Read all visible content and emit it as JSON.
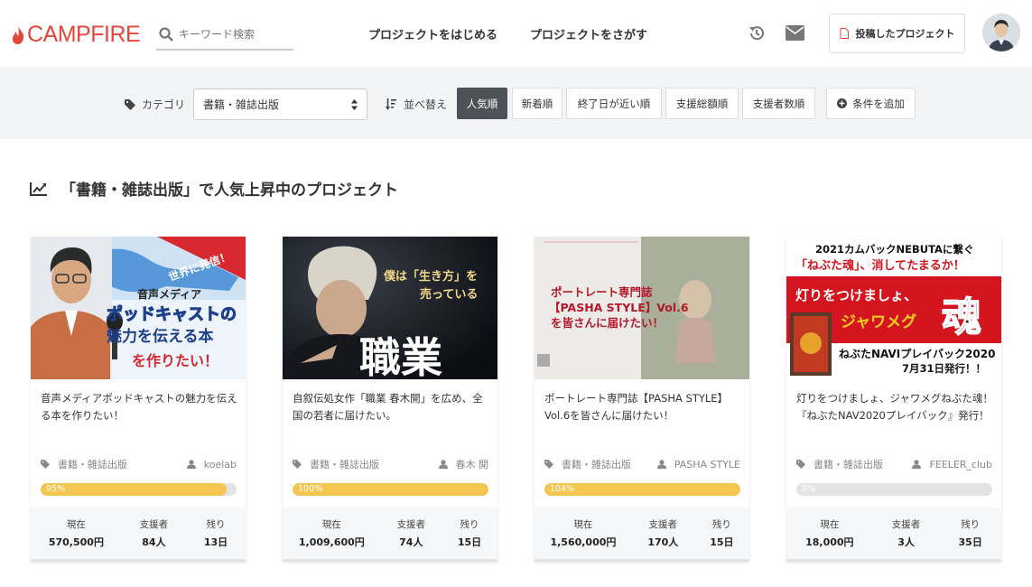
{
  "header": {
    "logo": "CAMPFIRE",
    "search_placeholder": "キーワード検索",
    "nav": [
      "プロジェクトをはじめる",
      "プロジェクトをさがす"
    ],
    "posted_projects": "投稿したプロジェクト"
  },
  "filters": {
    "category_label": "カテゴリ",
    "category_value": "書籍・雑誌出版",
    "sort_label": "並べ替え",
    "sort_options": [
      "人気順",
      "新着順",
      "終了日が近い順",
      "支援総額順",
      "支援者数順"
    ],
    "active_sort": "人気順",
    "add_condition": "条件を追加"
  },
  "section_title": "「書籍・雑誌出版」で人気上昇中のプロジェクト",
  "stat_labels": {
    "current": "現在",
    "backers": "支援者",
    "remaining": "残り"
  },
  "cards": [
    {
      "title": "音声メディアポッドキャストの魅力を伝える本を作りたい！",
      "category": "書籍・雑誌出版",
      "owner": "koelab",
      "progress_label": "95%",
      "progress_value": 0.95,
      "current": "570,500円",
      "backers": "84人",
      "remaining": "13日",
      "image_texts": [
        "世界に発信！",
        "音声メディア",
        "ポッドキャストの",
        "魅力を伝える本",
        "を作りたい！"
      ]
    },
    {
      "title": "自叙伝処女作「職業 春木開」を広め、全国の若者に届けたい。",
      "category": "書籍・雑誌出版",
      "owner": "春木 開",
      "progress_label": "100%",
      "progress_value": 1.0,
      "current": "1,009,600円",
      "backers": "74人",
      "remaining": "15日",
      "image_texts": [
        "僕は「生き方」を",
        "売っている",
        "職業"
      ]
    },
    {
      "title": "ポートレート専門誌【PASHA STYLE】Vol.6を皆さんに届けたい！",
      "category": "書籍・雑誌出版",
      "owner": "PASHA STYLE",
      "progress_label": "104%",
      "progress_value": 1.0,
      "current": "1,560,000円",
      "backers": "170人",
      "remaining": "15日",
      "image_texts": [
        "ポートレート専門誌",
        "【PASHA STYLE】Vol.6",
        "を皆さんに届けたい！"
      ]
    },
    {
      "title": "灯りをつけましょ、ジャワメグねぶた魂！『ねぶたNAV2020プレイバック』発行！",
      "category": "書籍・雑誌出版",
      "owner": "FEELER_club",
      "progress_label": "0%",
      "progress_value": 0,
      "current": "18,000円",
      "backers": "3人",
      "remaining": "35日",
      "image_texts": [
        "2021カムバックNEBUTAに繋ぐ",
        "「ねぶた魂」、消してたまるか！",
        "灯りをつけましょ、",
        "ジャワメグ",
        "魂",
        "ねぶたNAVIプレイバック2020",
        "7月31日発行！！"
      ]
    }
  ],
  "colors": {
    "brand": "#e5463b",
    "progress": "#f4c550",
    "active_sort": "#4d5158"
  }
}
